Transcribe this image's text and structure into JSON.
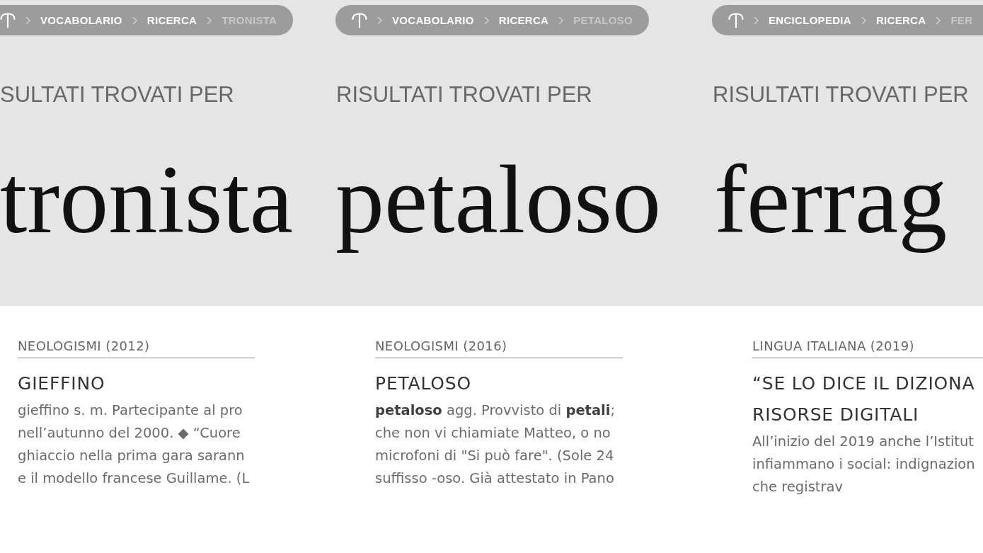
{
  "panels": [
    {
      "breadcrumb": {
        "items": [
          {
            "label": "VOCABOLARIO",
            "current": false
          },
          {
            "label": "RICERCA",
            "current": false
          },
          {
            "label": "TRONISTA",
            "current": true
          }
        ]
      },
      "heading": "SULTATI TROVATI PER",
      "query": "tronista",
      "result": {
        "category": "NEOLOGISMI (2012)",
        "title_lines": [
          "GIEFFINO"
        ],
        "excerpt_lines": [
          "gieffino s. m. Partecipante al pro",
          "nell’autunno del 2000. ◆ “Cuore",
          "ghiaccio nella prima gara sarann",
          "e il modello francese Guillame. (L"
        ]
      }
    },
    {
      "breadcrumb": {
        "items": [
          {
            "label": "VOCABOLARIO",
            "current": false
          },
          {
            "label": "RICERCA",
            "current": false
          },
          {
            "label": "PETALOSO",
            "current": true
          }
        ]
      },
      "heading": "RISULTATI TROVATI PER",
      "query": "petaloso",
      "result": {
        "category": "NEOLOGISMI (2016)",
        "title_lines": [
          "PETALOSO"
        ],
        "excerpt_lines": [
          "**petaloso** agg. Provvisto di **petali**;",
          "che non vi chiamiate Matteo, o no",
          "microfoni di \"Si può fare\". (Sole 24",
          "suffisso -oso. Già attestato in Pano"
        ]
      }
    },
    {
      "breadcrumb": {
        "items": [
          {
            "label": "ENCICLOPEDIA",
            "current": false
          },
          {
            "label": "RICERCA",
            "current": false
          },
          {
            "label": "FER",
            "current": true
          }
        ]
      },
      "heading": "RISULTATI TROVATI PER",
      "query": "ferrag",
      "result": {
        "category": "LINGUA ITALIANA (2019)",
        "title_lines": [
          "“SE LO DICE IL DIZIONA",
          "RISORSE DIGITALI"
        ],
        "excerpt_lines": [
          "All’inizio del 2019 anche l’Istitut",
          "infiammano i social: indignazion",
          "che registrav"
        ]
      }
    }
  ]
}
